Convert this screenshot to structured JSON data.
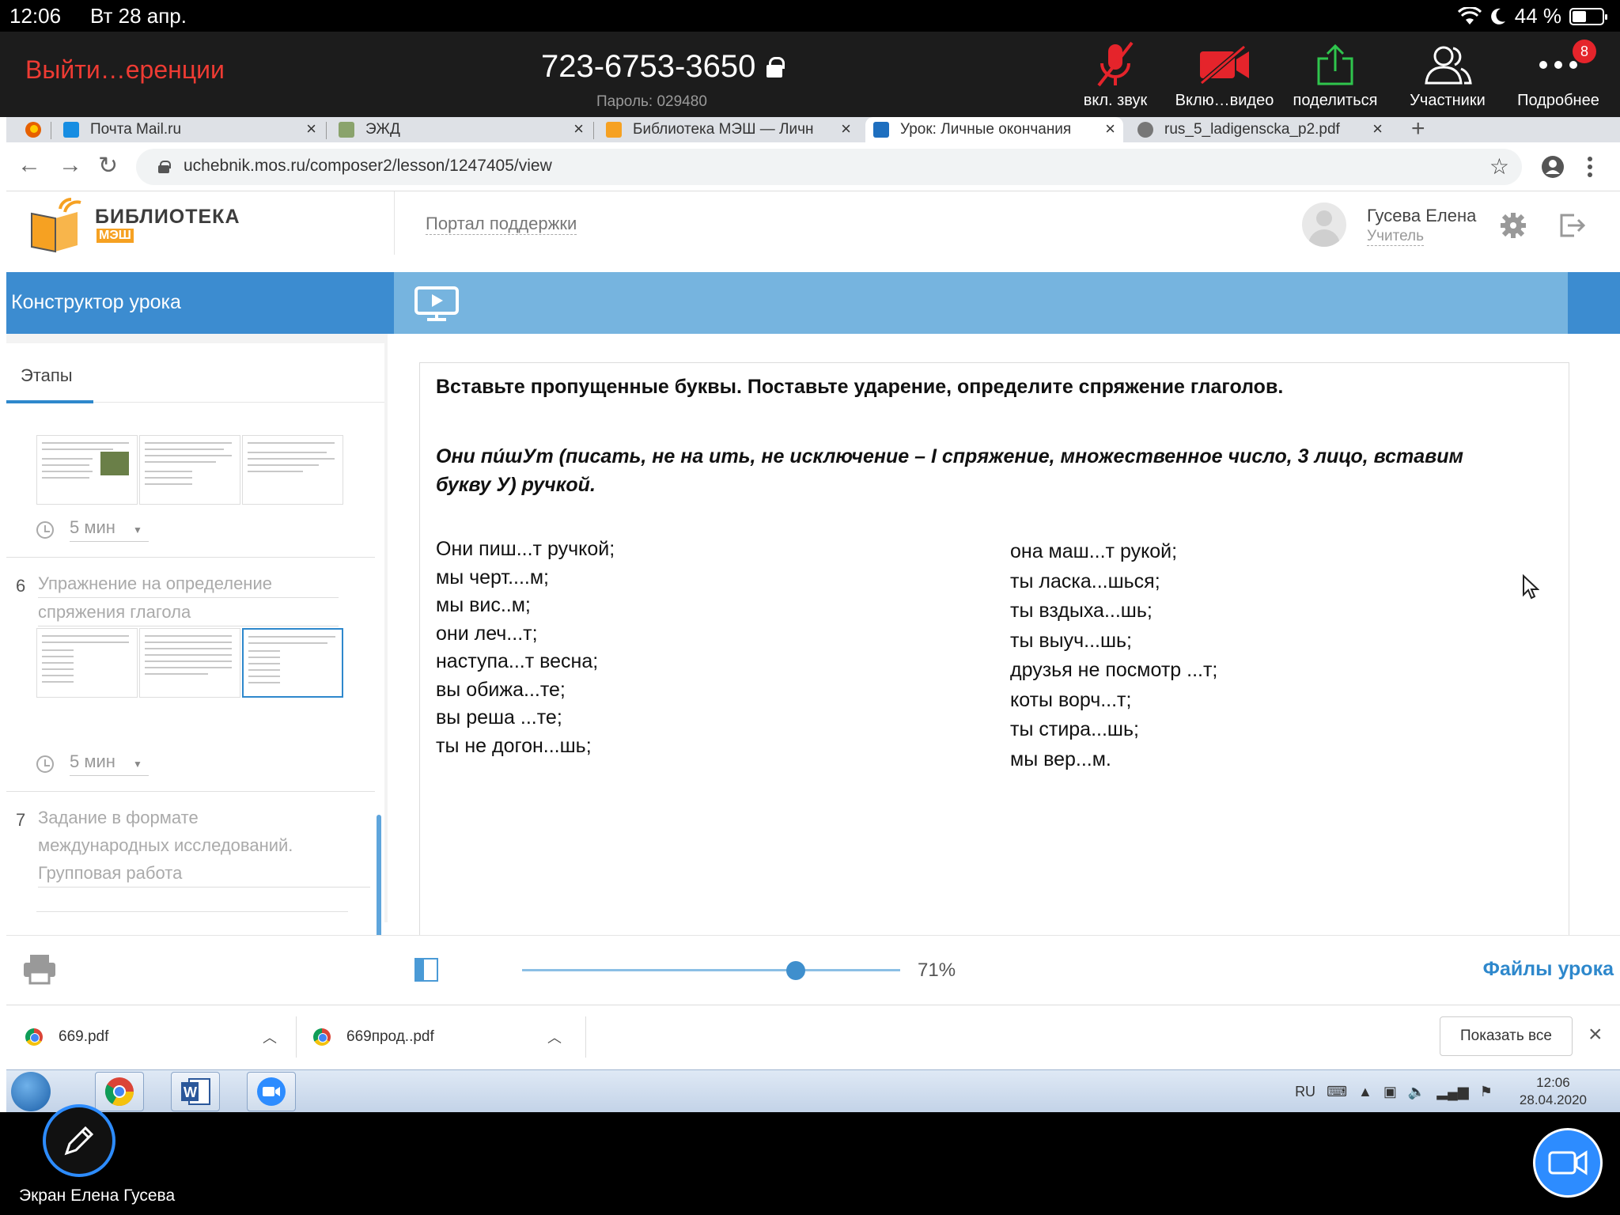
{
  "status_bar": {
    "time": "12:06",
    "date": "Вт 28 апр.",
    "battery": "44 %"
  },
  "zoom": {
    "leave_label": "Выйти…еренции",
    "meeting_id": "723-6753-3650",
    "password": "Пароль: 029480",
    "buttons": {
      "audio": "вкл. звук",
      "video": "Вклю…видео",
      "share": "поделиться",
      "participants": "Участники",
      "more": "Подробнее"
    },
    "more_badge": "8",
    "screen_label": "Экран Елена Гусева"
  },
  "browser": {
    "tabs": [
      {
        "title": "Почта Mail.ru"
      },
      {
        "title": "ЭЖД"
      },
      {
        "title": "Библиотека МЭШ — Личн"
      },
      {
        "title": "Урок: Личные окончания"
      },
      {
        "title": "rus_5_ladigenscka_p2.pdf"
      }
    ],
    "url": "uchebnik.mos.ru/composer2/lesson/1247405/view"
  },
  "library": {
    "logo_title": "БИБЛИОТЕКА",
    "logo_sub": "МЭШ",
    "support_link": "Портал поддержки",
    "user_name": "Гусева Елена",
    "user_role": "Учитель",
    "constructor_title": "Конструктор урока",
    "stages_tab": "Этапы",
    "stages": [
      {
        "number": "",
        "title_lines": [],
        "duration": "5 мин"
      },
      {
        "number": "6",
        "title_lines": [
          "Упражнение на определение",
          "спряжения глагола"
        ],
        "duration": "5 мин"
      },
      {
        "number": "7",
        "title_lines": [
          "Задание в формате",
          "международных исследований.",
          "Групповая работа"
        ],
        "duration": ""
      }
    ],
    "zoom_percent": "71%",
    "files_link": "Файлы урока"
  },
  "exercise": {
    "task": "Вставьте пропущенные буквы. Поставьте ударение, определите спряжение глаголов.",
    "example_line1": "Они пи́шУт (писать, не на ить, не исключение – I спряжение, множественное число, 3 лицо, вставим",
    "example_line2": "букву У) ручкой.",
    "left_column": [
      "Они пиш...т ручкой;",
      "мы черт....м;",
      "мы вис..м;",
      "они леч...т;",
      "наступа...т весна;",
      "вы обижа...те;",
      "вы реша ...те;",
      "ты не догон...шь;"
    ],
    "right_column": [
      "она маш...т рукой;",
      "ты ласка...шься;",
      "ты вздыха...шь;",
      "ты выуч...шь;",
      "друзья не посмотр ...т;",
      "коты ворч...т;",
      "ты стира...шь;",
      "мы вер...м."
    ]
  },
  "downloads": {
    "items": [
      {
        "name": "669.pdf"
      },
      {
        "name": "669прод..pdf"
      }
    ],
    "show_all": "Показать все"
  },
  "taskbar": {
    "language": "RU",
    "time": "12:06",
    "date": "28.04.2020"
  },
  "colors": {
    "zoom_leave": "#ee3b33",
    "zoom_toolbar": "#1c1c1c",
    "library_blue": "#3c8cd0",
    "library_blue_light": "#76b4df",
    "library_orange": "#f6a122",
    "share_green": "#2fc54d"
  }
}
